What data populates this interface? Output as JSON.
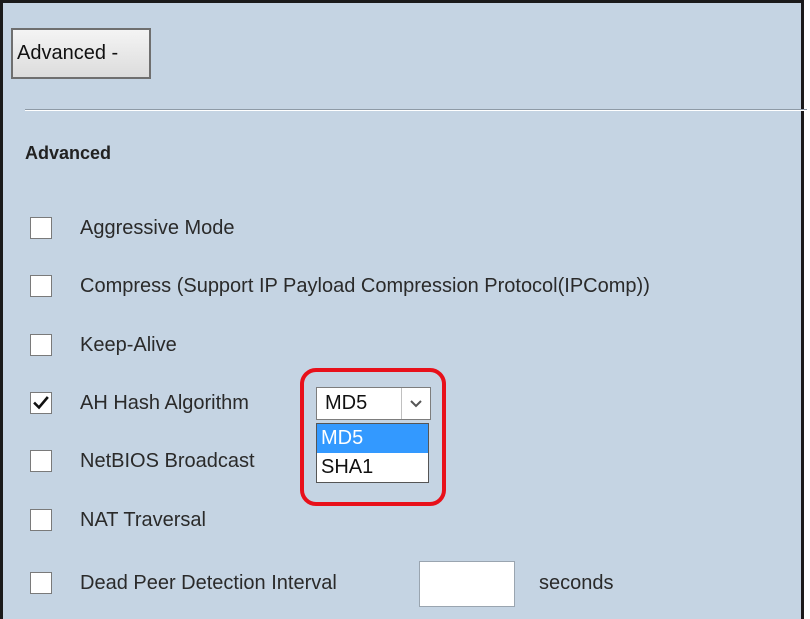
{
  "toggle_button": {
    "label": "Advanced -"
  },
  "section": {
    "title": "Advanced"
  },
  "options": {
    "aggressive_mode": {
      "label": "Aggressive Mode",
      "checked": false
    },
    "compress": {
      "label": "Compress (Support IP Payload Compression Protocol(IPComp))",
      "checked": false
    },
    "keep_alive": {
      "label": "Keep-Alive",
      "checked": false
    },
    "ah_hash": {
      "label": "AH Hash Algorithm",
      "checked": true
    },
    "netbios": {
      "label": "NetBIOS Broadcast",
      "checked": false
    },
    "nat_traversal": {
      "label": "NAT Traversal",
      "checked": false
    },
    "dpd": {
      "label": "Dead Peer Detection Interval",
      "checked": false,
      "unit": "seconds",
      "value": ""
    }
  },
  "ah_hash_select": {
    "selected": "MD5",
    "options": [
      "MD5",
      "SHA1"
    ],
    "highlighted_option": "MD5"
  },
  "colors": {
    "panel_bg": "#c5d4e3",
    "highlight_ring": "#e8101a",
    "option_highlight": "#3399ff"
  },
  "icons": {
    "checkmark": "check-icon",
    "dropdown_arrow": "chevron-down-icon"
  }
}
